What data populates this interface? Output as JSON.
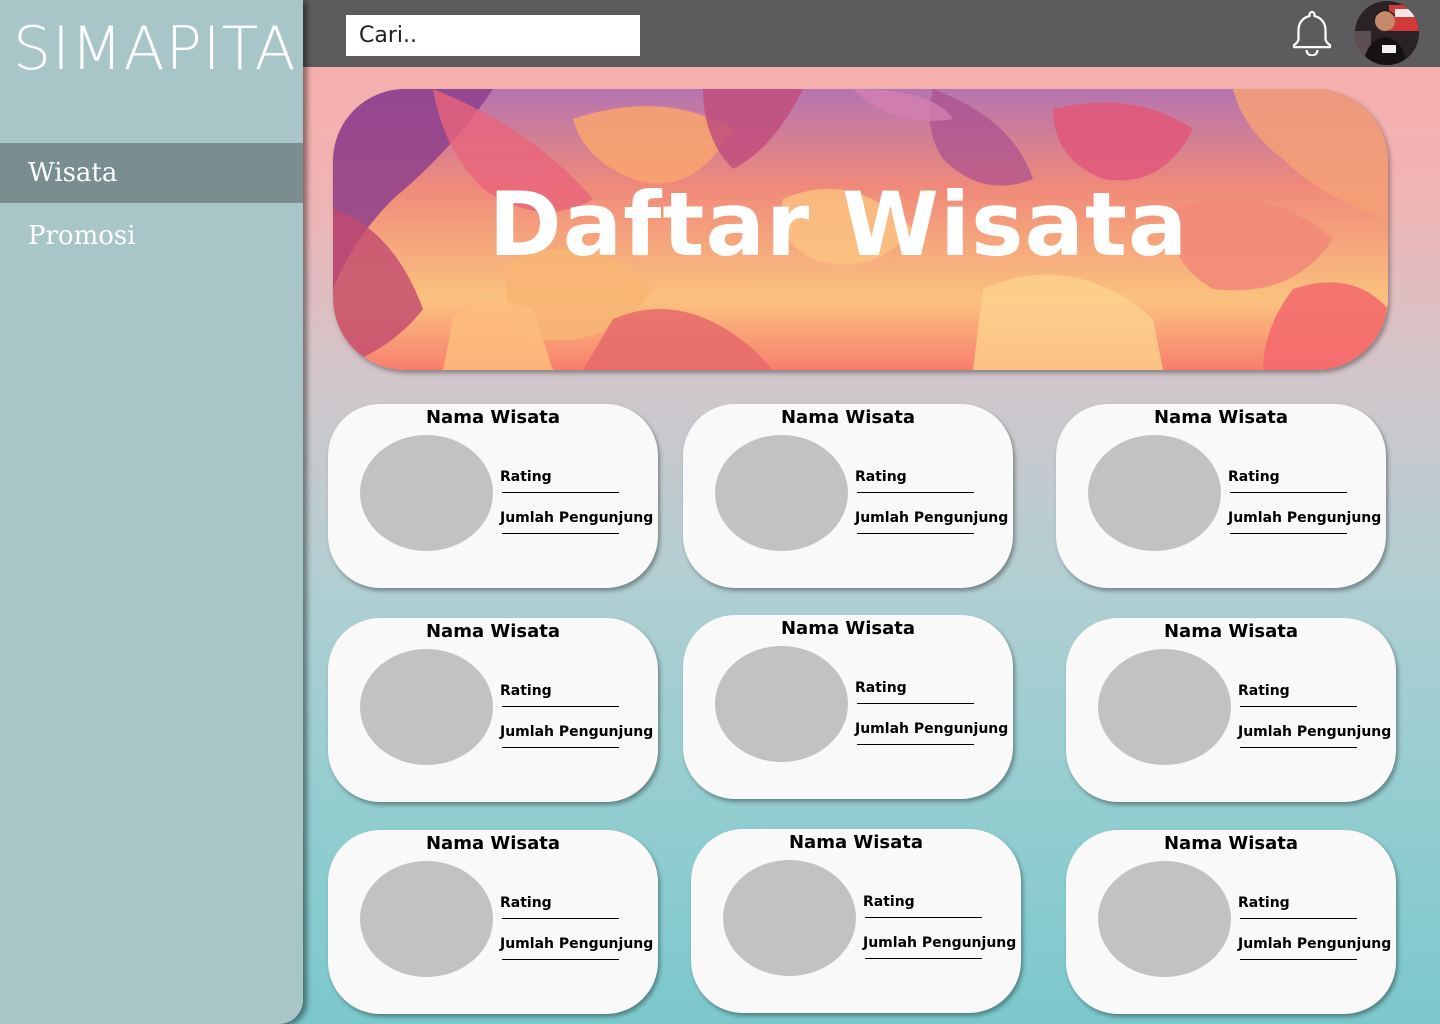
{
  "app": {
    "brand": "SIMAPITA"
  },
  "sidebar": {
    "items": [
      {
        "label": "Wisata",
        "active": true
      },
      {
        "label": "Promosi",
        "active": false
      }
    ]
  },
  "header": {
    "search_placeholder": "Cari..",
    "notification_icon": "bell-icon",
    "avatar_icon": "user-avatar"
  },
  "banner": {
    "title": "Daftar Wisata"
  },
  "cards": [
    {
      "title": "Nama Wisata",
      "rating_label": "Rating",
      "visitors_label": "Jumlah Pengunjung"
    },
    {
      "title": "Nama Wisata",
      "rating_label": "Rating",
      "visitors_label": "Jumlah Pengunjung"
    },
    {
      "title": "Nama Wisata",
      "rating_label": "Rating",
      "visitors_label": "Jumlah Pengunjung"
    },
    {
      "title": "Nama Wisata",
      "rating_label": "Rating",
      "visitors_label": "Jumlah Pengunjung"
    },
    {
      "title": "Nama Wisata",
      "rating_label": "Rating",
      "visitors_label": "Jumlah Pengunjung"
    },
    {
      "title": "Nama Wisata",
      "rating_label": "Rating",
      "visitors_label": "Jumlah Pengunjung"
    },
    {
      "title": "Nama Wisata",
      "rating_label": "Rating",
      "visitors_label": "Jumlah Pengunjung"
    },
    {
      "title": "Nama Wisata",
      "rating_label": "Rating",
      "visitors_label": "Jumlah Pengunjung"
    },
    {
      "title": "Nama Wisata",
      "rating_label": "Rating",
      "visitors_label": "Jumlah Pengunjung"
    }
  ],
  "colors": {
    "sidebar": "#a8c5c8",
    "sidebar_active": "#7a8d8f",
    "topbar": "#5d5b5e",
    "card": "#f9f9f9",
    "card_image_placeholder": "#c2c2c2"
  }
}
